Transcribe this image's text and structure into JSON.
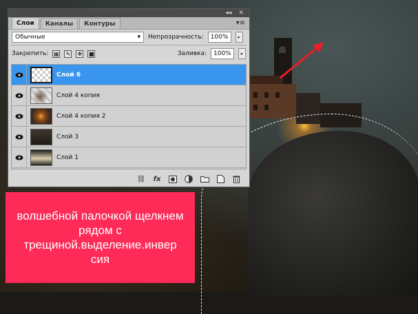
{
  "panel": {
    "topbar_collapse": "◂◂",
    "topbar_close": "✕",
    "tabs": [
      {
        "label": "Слои",
        "active": true
      },
      {
        "label": "Каналы",
        "active": false
      },
      {
        "label": "Контуры",
        "active": false
      }
    ],
    "menu_icon": "panel-menu-icon",
    "blend_mode": "Обычные",
    "opacity_label": "Непрозрачность:",
    "opacity_value": "100%",
    "lock_label": "Закрепить:",
    "fill_label": "Заливка:",
    "fill_value": "100%",
    "layers": [
      {
        "name": "Слой 6",
        "selected": true
      },
      {
        "name": "Слой 4 копия",
        "selected": false
      },
      {
        "name": "Слой 4 копия 2",
        "selected": false
      },
      {
        "name": "Слой 3",
        "selected": false
      },
      {
        "name": "Слой 1",
        "selected": false
      }
    ],
    "footer_icons": [
      "link-icon",
      "fx-icon",
      "mask-icon",
      "adjustment-icon",
      "group-folder-icon",
      "new-layer-icon",
      "trash-icon"
    ],
    "fx_label": "fx"
  },
  "caption": {
    "text": "волшебной палочкой щелкнем рядом с трещиной.выделение.инвер сия"
  },
  "colors": {
    "caption_bg": "#fe2a57",
    "selected_layer": "#3a95ee",
    "arrow": "#ee1c24"
  }
}
